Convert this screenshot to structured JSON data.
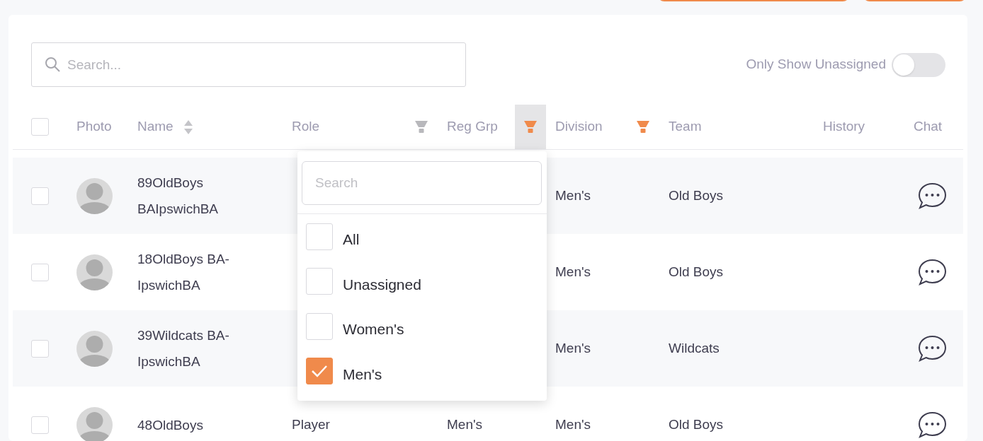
{
  "search": {
    "placeholder": "Search..."
  },
  "toggle": {
    "label": "Only Show Unassigned",
    "on": false
  },
  "table": {
    "select_all_checked": false,
    "columns": [
      {
        "label": "Photo"
      },
      {
        "label": "Name",
        "sortable": true
      },
      {
        "label": "Role",
        "filter_active": false
      },
      {
        "label": "Reg Grp",
        "filter_active": true,
        "open": true
      },
      {
        "label": "Division",
        "filter_active": true
      },
      {
        "label": "Team"
      },
      {
        "label": "History"
      },
      {
        "label": "Chat"
      }
    ],
    "rows": [
      {
        "checked": false,
        "name": "89OldBoys BAIpswichBA",
        "division": "Men's",
        "team": "Old Boys"
      },
      {
        "checked": false,
        "name": "18OldBoys BA-IpswichBA",
        "division": "Men's",
        "team": "Old Boys"
      },
      {
        "checked": false,
        "name": "39Wildcats BA-IpswichBA",
        "division": "Men's",
        "team": "Wildcats"
      },
      {
        "checked": false,
        "name": "48OldBoys",
        "role": "Player",
        "reg_grp": "Men's",
        "division": "Men's",
        "team": "Old Boys"
      }
    ]
  },
  "filter_menu": {
    "placeholder": "Search",
    "options": [
      {
        "label": "All",
        "checked": false
      },
      {
        "label": "Unassigned",
        "checked": false
      },
      {
        "label": "Women's",
        "checked": false
      },
      {
        "label": "Men's",
        "checked": true
      }
    ]
  }
}
